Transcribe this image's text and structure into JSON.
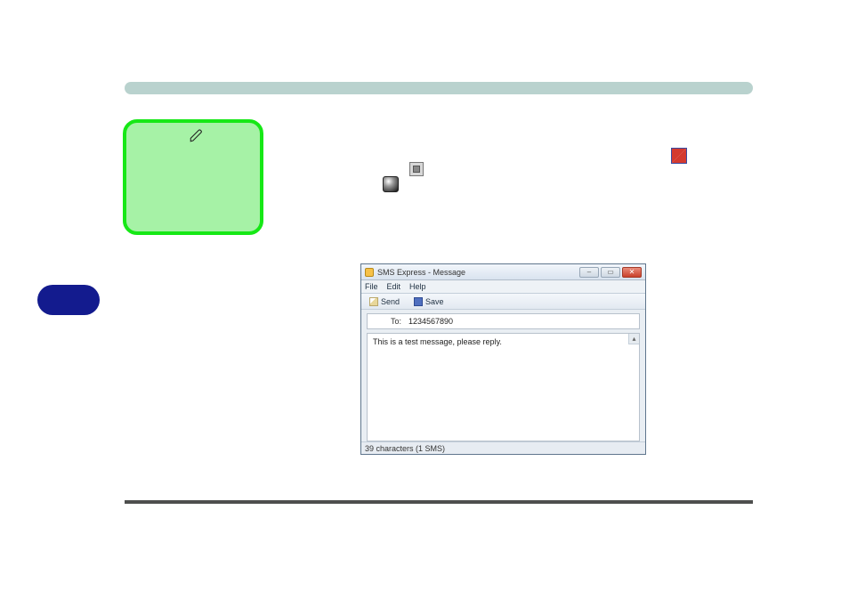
{
  "header_bar": {},
  "sticky_note": {
    "icon": "pen-icon"
  },
  "mid_icons": {
    "stop": "stop-icon",
    "sphere": "sphere-icon"
  },
  "flag_icon": "flag-icon",
  "blue_pill": {},
  "sms_window": {
    "title": "SMS Express - Message",
    "menu": {
      "file": "File",
      "edit": "Edit",
      "help": "Help"
    },
    "toolbar": {
      "send_label": "Send",
      "save_label": "Save"
    },
    "to_label": "To:",
    "to_value": "1234567890",
    "body": "This is a test message, please reply.",
    "status": "39 characters (1 SMS)",
    "win_buttons": {
      "minimize": "–",
      "maximize": "▭",
      "close": "✕"
    },
    "scroll_up": "▴"
  }
}
